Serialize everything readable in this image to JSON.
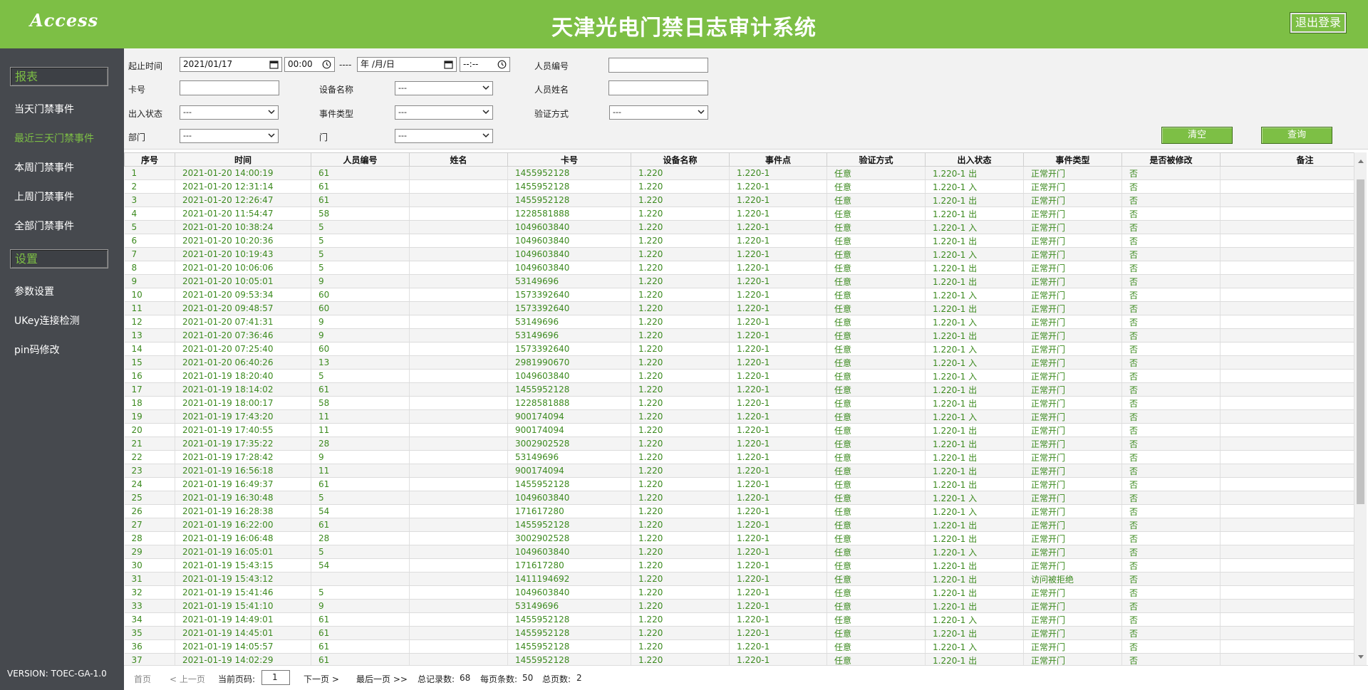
{
  "header": {
    "logo": "Access",
    "title": "天津光电门禁日志审计系统",
    "logout_label": "退出登录"
  },
  "sidebar": {
    "reports_heading": "报表",
    "reports": [
      "当天门禁事件",
      "最近三天门禁事件",
      "本周门禁事件",
      "上周门禁事件",
      "全部门禁事件"
    ],
    "active_report": "最近三天门禁事件",
    "settings_heading": "设置",
    "settings": [
      "参数设置",
      "UKey连接检测",
      "pin码修改"
    ],
    "version": "VERSION: TOEC-GA-1.0"
  },
  "filter": {
    "start_label": "起止时间",
    "start_date": "2021/01/17",
    "start_time": "00:00",
    "range_sep": "----",
    "end_date": " 年 /月/日",
    "end_time": "--:--",
    "person_id_label": "人员编号",
    "person_id_value": "",
    "card_label": "卡号",
    "card_value": "",
    "device_label": "设备名称",
    "device_value": "---",
    "person_name_label": "人员姓名",
    "person_name_value": "",
    "inout_label": "出入状态",
    "inout_value": "---",
    "event_type_label": "事件类型",
    "event_type_value": "---",
    "verify_label": "验证方式",
    "verify_value": "---",
    "dept_label": "部门",
    "dept_value": "---",
    "door_label": "门",
    "door_value": "---",
    "clear_label": "清空",
    "query_label": "查询"
  },
  "table": {
    "columns": [
      "序号",
      "时间",
      "人员编号",
      "姓名",
      "卡号",
      "设备名称",
      "事件点",
      "验证方式",
      "出入状态",
      "事件类型",
      "是否被修改",
      "备注"
    ],
    "rows": [
      [
        "1",
        "2021-01-20 14:00:19",
        "61",
        "",
        "1455952128",
        "1.220",
        "1.220-1",
        "任意",
        "1.220-1 出",
        "正常开门",
        "否",
        ""
      ],
      [
        "2",
        "2021-01-20 12:31:14",
        "61",
        "",
        "1455952128",
        "1.220",
        "1.220-1",
        "任意",
        "1.220-1 入",
        "正常开门",
        "否",
        ""
      ],
      [
        "3",
        "2021-01-20 12:26:47",
        "61",
        "",
        "1455952128",
        "1.220",
        "1.220-1",
        "任意",
        "1.220-1 出",
        "正常开门",
        "否",
        ""
      ],
      [
        "4",
        "2021-01-20 11:54:47",
        "58",
        "",
        "1228581888",
        "1.220",
        "1.220-1",
        "任意",
        "1.220-1 出",
        "正常开门",
        "否",
        ""
      ],
      [
        "5",
        "2021-01-20 10:38:24",
        "5",
        "",
        "1049603840",
        "1.220",
        "1.220-1",
        "任意",
        "1.220-1 入",
        "正常开门",
        "否",
        ""
      ],
      [
        "6",
        "2021-01-20 10:20:36",
        "5",
        "",
        "1049603840",
        "1.220",
        "1.220-1",
        "任意",
        "1.220-1 出",
        "正常开门",
        "否",
        ""
      ],
      [
        "7",
        "2021-01-20 10:19:43",
        "5",
        "",
        "1049603840",
        "1.220",
        "1.220-1",
        "任意",
        "1.220-1 入",
        "正常开门",
        "否",
        ""
      ],
      [
        "8",
        "2021-01-20 10:06:06",
        "5",
        "",
        "1049603840",
        "1.220",
        "1.220-1",
        "任意",
        "1.220-1 出",
        "正常开门",
        "否",
        ""
      ],
      [
        "9",
        "2021-01-20 10:05:01",
        "9",
        "",
        "53149696",
        "1.220",
        "1.220-1",
        "任意",
        "1.220-1 出",
        "正常开门",
        "否",
        ""
      ],
      [
        "10",
        "2021-01-20 09:53:34",
        "60",
        "",
        "1573392640",
        "1.220",
        "1.220-1",
        "任意",
        "1.220-1 入",
        "正常开门",
        "否",
        ""
      ],
      [
        "11",
        "2021-01-20 09:48:57",
        "60",
        "",
        "1573392640",
        "1.220",
        "1.220-1",
        "任意",
        "1.220-1 出",
        "正常开门",
        "否",
        ""
      ],
      [
        "12",
        "2021-01-20 07:41:31",
        "9",
        "",
        "53149696",
        "1.220",
        "1.220-1",
        "任意",
        "1.220-1 入",
        "正常开门",
        "否",
        ""
      ],
      [
        "13",
        "2021-01-20 07:36:46",
        "9",
        "",
        "53149696",
        "1.220",
        "1.220-1",
        "任意",
        "1.220-1 出",
        "正常开门",
        "否",
        ""
      ],
      [
        "14",
        "2021-01-20 07:25:40",
        "60",
        "",
        "1573392640",
        "1.220",
        "1.220-1",
        "任意",
        "1.220-1 入",
        "正常开门",
        "否",
        ""
      ],
      [
        "15",
        "2021-01-20 06:40:26",
        "13",
        "",
        "2981990670",
        "1.220",
        "1.220-1",
        "任意",
        "1.220-1 入",
        "正常开门",
        "否",
        ""
      ],
      [
        "16",
        "2021-01-19 18:20:40",
        "5",
        "",
        "1049603840",
        "1.220",
        "1.220-1",
        "任意",
        "1.220-1 入",
        "正常开门",
        "否",
        ""
      ],
      [
        "17",
        "2021-01-19 18:14:02",
        "61",
        "",
        "1455952128",
        "1.220",
        "1.220-1",
        "任意",
        "1.220-1 出",
        "正常开门",
        "否",
        ""
      ],
      [
        "18",
        "2021-01-19 18:00:17",
        "58",
        "",
        "1228581888",
        "1.220",
        "1.220-1",
        "任意",
        "1.220-1 出",
        "正常开门",
        "否",
        ""
      ],
      [
        "19",
        "2021-01-19 17:43:20",
        "11",
        "",
        "900174094",
        "1.220",
        "1.220-1",
        "任意",
        "1.220-1 入",
        "正常开门",
        "否",
        ""
      ],
      [
        "20",
        "2021-01-19 17:40:55",
        "11",
        "",
        "900174094",
        "1.220",
        "1.220-1",
        "任意",
        "1.220-1 出",
        "正常开门",
        "否",
        ""
      ],
      [
        "21",
        "2021-01-19 17:35:22",
        "28",
        "",
        "3002902528",
        "1.220",
        "1.220-1",
        "任意",
        "1.220-1 出",
        "正常开门",
        "否",
        ""
      ],
      [
        "22",
        "2021-01-19 17:28:42",
        "9",
        "",
        "53149696",
        "1.220",
        "1.220-1",
        "任意",
        "1.220-1 出",
        "正常开门",
        "否",
        ""
      ],
      [
        "23",
        "2021-01-19 16:56:18",
        "11",
        "",
        "900174094",
        "1.220",
        "1.220-1",
        "任意",
        "1.220-1 出",
        "正常开门",
        "否",
        ""
      ],
      [
        "24",
        "2021-01-19 16:49:37",
        "61",
        "",
        "1455952128",
        "1.220",
        "1.220-1",
        "任意",
        "1.220-1 出",
        "正常开门",
        "否",
        ""
      ],
      [
        "25",
        "2021-01-19 16:30:48",
        "5",
        "",
        "1049603840",
        "1.220",
        "1.220-1",
        "任意",
        "1.220-1 入",
        "正常开门",
        "否",
        ""
      ],
      [
        "26",
        "2021-01-19 16:28:38",
        "54",
        "",
        "171617280",
        "1.220",
        "1.220-1",
        "任意",
        "1.220-1 入",
        "正常开门",
        "否",
        ""
      ],
      [
        "27",
        "2021-01-19 16:22:00",
        "61",
        "",
        "1455952128",
        "1.220",
        "1.220-1",
        "任意",
        "1.220-1 出",
        "正常开门",
        "否",
        ""
      ],
      [
        "28",
        "2021-01-19 16:06:48",
        "28",
        "",
        "3002902528",
        "1.220",
        "1.220-1",
        "任意",
        "1.220-1 出",
        "正常开门",
        "否",
        ""
      ],
      [
        "29",
        "2021-01-19 16:05:01",
        "5",
        "",
        "1049603840",
        "1.220",
        "1.220-1",
        "任意",
        "1.220-1 入",
        "正常开门",
        "否",
        ""
      ],
      [
        "30",
        "2021-01-19 15:43:15",
        "54",
        "",
        "171617280",
        "1.220",
        "1.220-1",
        "任意",
        "1.220-1 出",
        "正常开门",
        "否",
        ""
      ],
      [
        "31",
        "2021-01-19 15:43:12",
        "",
        "",
        "1411194692",
        "1.220",
        "1.220-1",
        "任意",
        "1.220-1 出",
        "访问被拒绝",
        "否",
        ""
      ],
      [
        "32",
        "2021-01-19 15:41:46",
        "5",
        "",
        "1049603840",
        "1.220",
        "1.220-1",
        "任意",
        "1.220-1 出",
        "正常开门",
        "否",
        ""
      ],
      [
        "33",
        "2021-01-19 15:41:10",
        "9",
        "",
        "53149696",
        "1.220",
        "1.220-1",
        "任意",
        "1.220-1 出",
        "正常开门",
        "否",
        ""
      ],
      [
        "34",
        "2021-01-19 14:49:01",
        "61",
        "",
        "1455952128",
        "1.220",
        "1.220-1",
        "任意",
        "1.220-1 入",
        "正常开门",
        "否",
        ""
      ],
      [
        "35",
        "2021-01-19 14:45:01",
        "61",
        "",
        "1455952128",
        "1.220",
        "1.220-1",
        "任意",
        "1.220-1 出",
        "正常开门",
        "否",
        ""
      ],
      [
        "36",
        "2021-01-19 14:05:57",
        "61",
        "",
        "1455952128",
        "1.220",
        "1.220-1",
        "任意",
        "1.220-1 入",
        "正常开门",
        "否",
        ""
      ],
      [
        "37",
        "2021-01-19 14:02:29",
        "61",
        "",
        "1455952128",
        "1.220",
        "1.220-1",
        "任意",
        "1.220-1 出",
        "正常开门",
        "否",
        ""
      ]
    ]
  },
  "pager": {
    "first": "首页",
    "prev": "< 上一页",
    "current_label": "当前页码:",
    "current_page": "1",
    "next": "下一页 >",
    "last": "最后一页 >>",
    "total_records_label": "总记录数:",
    "total_records": "68",
    "per_page_label": "每页条数:",
    "per_page": "50",
    "total_pages_label": "总页数:",
    "total_pages": "2"
  }
}
